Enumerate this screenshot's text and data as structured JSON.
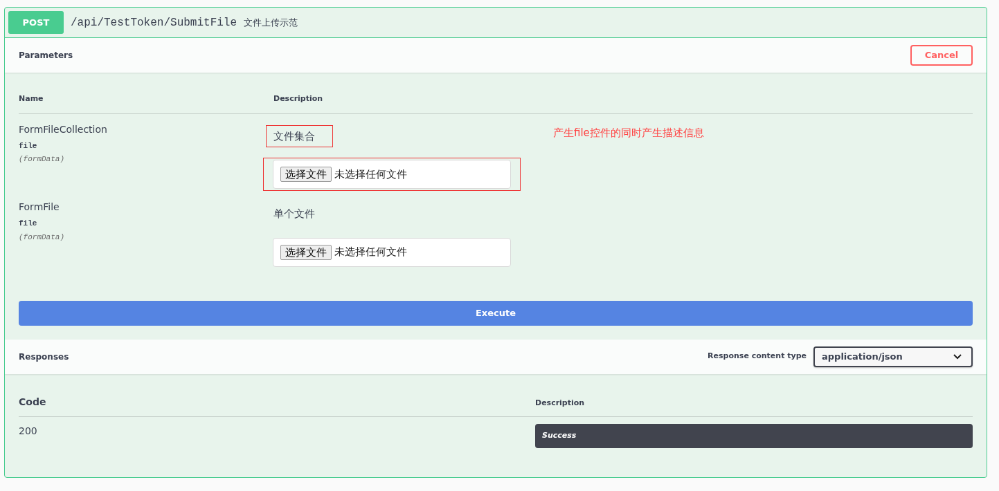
{
  "operation": {
    "method": "POST",
    "path": "/api/TestToken/SubmitFile",
    "summary": "文件上传示范"
  },
  "parameters_bar": {
    "title": "Parameters",
    "cancel_button": "Cancel"
  },
  "parameters_table": {
    "columns": [
      "Name",
      "Description"
    ],
    "rows": [
      {
        "name": "FormFileCollection",
        "type": "file",
        "location": "(formData)",
        "description": "文件集合",
        "description_highlighted": true,
        "file_button": "选择文件",
        "file_status": "未选择任何文件",
        "input_highlighted": true,
        "annotation": "产生file控件的同时产生描述信息"
      },
      {
        "name": "FormFile",
        "type": "file",
        "location": "(formData)",
        "description": "单个文件",
        "description_highlighted": false,
        "file_button": "选择文件",
        "file_status": "未选择任何文件",
        "input_highlighted": false
      }
    ]
  },
  "execute_button": "Execute",
  "responses_bar": {
    "title": "Responses",
    "content_type_label": "Response content type",
    "content_type": "application/json"
  },
  "responses_table": {
    "columns": [
      "Code",
      "Description"
    ],
    "rows": [
      {
        "code": "200",
        "description": "Success"
      }
    ]
  }
}
